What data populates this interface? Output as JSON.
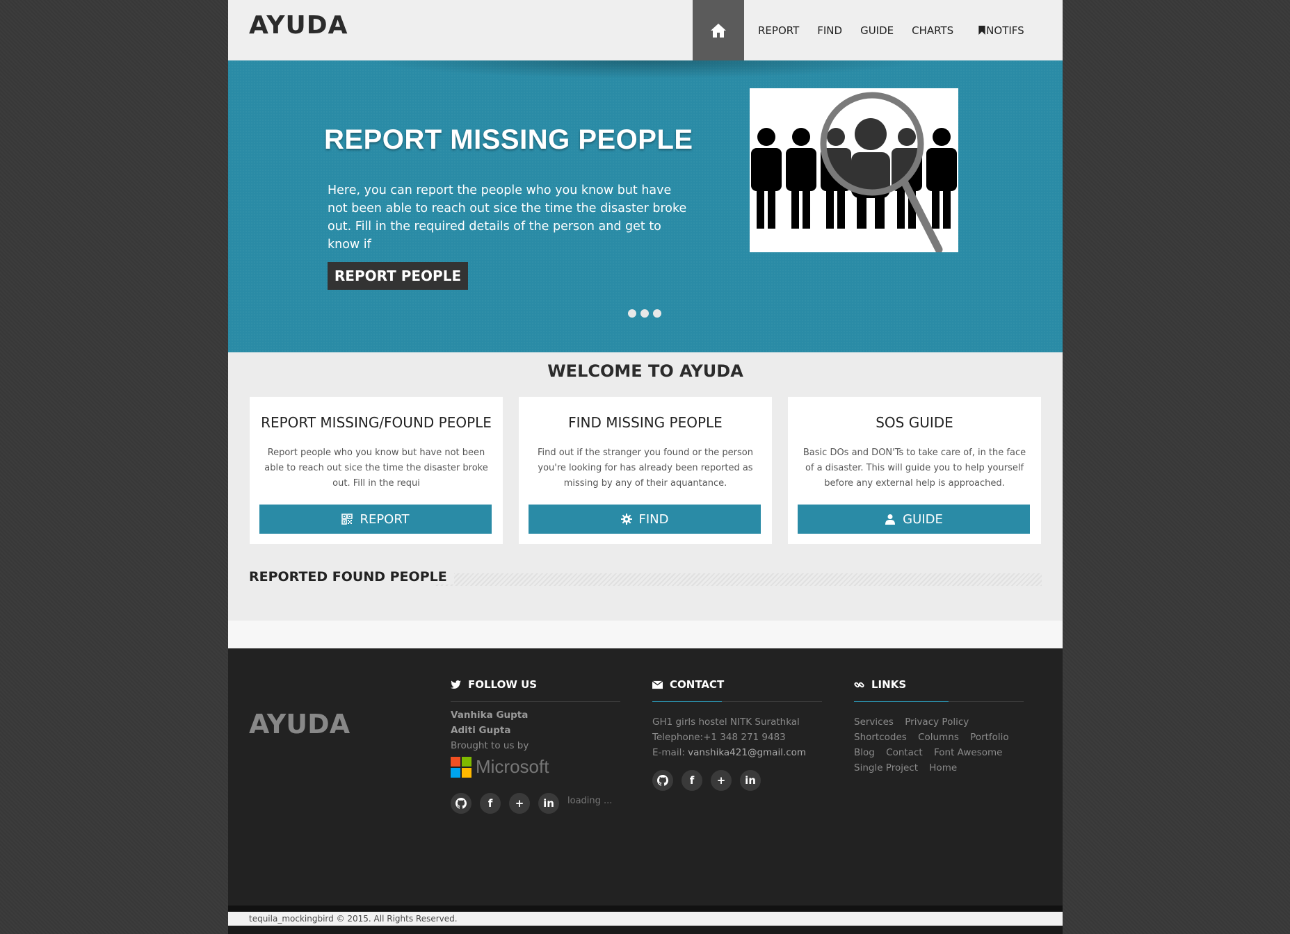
{
  "header": {
    "logo": "AYUDA",
    "nav": [
      {
        "label": "REPORT"
      },
      {
        "label": "FIND"
      },
      {
        "label": "GUIDE"
      },
      {
        "label": "CHARTS"
      },
      {
        "label": "NOTIFS"
      }
    ]
  },
  "hero": {
    "title": "REPORT MISSING PEOPLE",
    "text": "Here, you can report the people who you know but have not been able to reach out sice the time the disaster broke out. Fill in the required details of the person and get to know if",
    "button": "REPORT PEOPLE",
    "slide_count": 3
  },
  "welcome": {
    "title": "WELCOME TO AYUDA",
    "cards": [
      {
        "title": "REPORT MISSING/FOUND PEOPLE",
        "text": "Report people who you know but have not been able to reach out sice the time the disaster broke out. Fill in the requi",
        "button": "REPORT",
        "icon": "qrcode-icon"
      },
      {
        "title": "FIND MISSING PEOPLE",
        "text": "Find out if the stranger you found or the person you're looking for has already been reported as missing by any of their aquantance.",
        "button": "FIND",
        "icon": "gear-icon"
      },
      {
        "title": "SOS GUIDE",
        "text": "Basic DOs and DON'Ts to take care of, in the face of a disaster. This will guide you to help yourself before any external help is approached.",
        "button": "GUIDE",
        "icon": "user-icon"
      }
    ]
  },
  "reported_found": {
    "title": "REPORTED FOUND PEOPLE"
  },
  "footer": {
    "logo": "AYUDA",
    "follow": {
      "heading": "FOLLOW US",
      "names": [
        "Vanhika Gupta",
        "Aditi Gupta"
      ],
      "brought": "Brought to us by",
      "brand": "Microsoft",
      "loading": "loading ..."
    },
    "contact": {
      "heading": "CONTACT",
      "address": "GH1 girls hostel NITK Surathkal",
      "telephone": "Telephone:+1 348 271 9483",
      "email_label": "E-mail: ",
      "email": "vanshika421@gmail.com"
    },
    "links": {
      "heading": "LINKS",
      "items": [
        "Services",
        "Privacy Policy",
        "Shortcodes",
        "Columns",
        "Portfolio",
        "Blog",
        "Contact",
        "Font Awesome",
        "Single Project",
        "Home"
      ]
    },
    "copyright": "tequila_mockingbird © 2015. All Rights Reserved."
  },
  "colors": {
    "accent": "#2a8ba6",
    "dark": "#222222",
    "background": "#393939"
  }
}
